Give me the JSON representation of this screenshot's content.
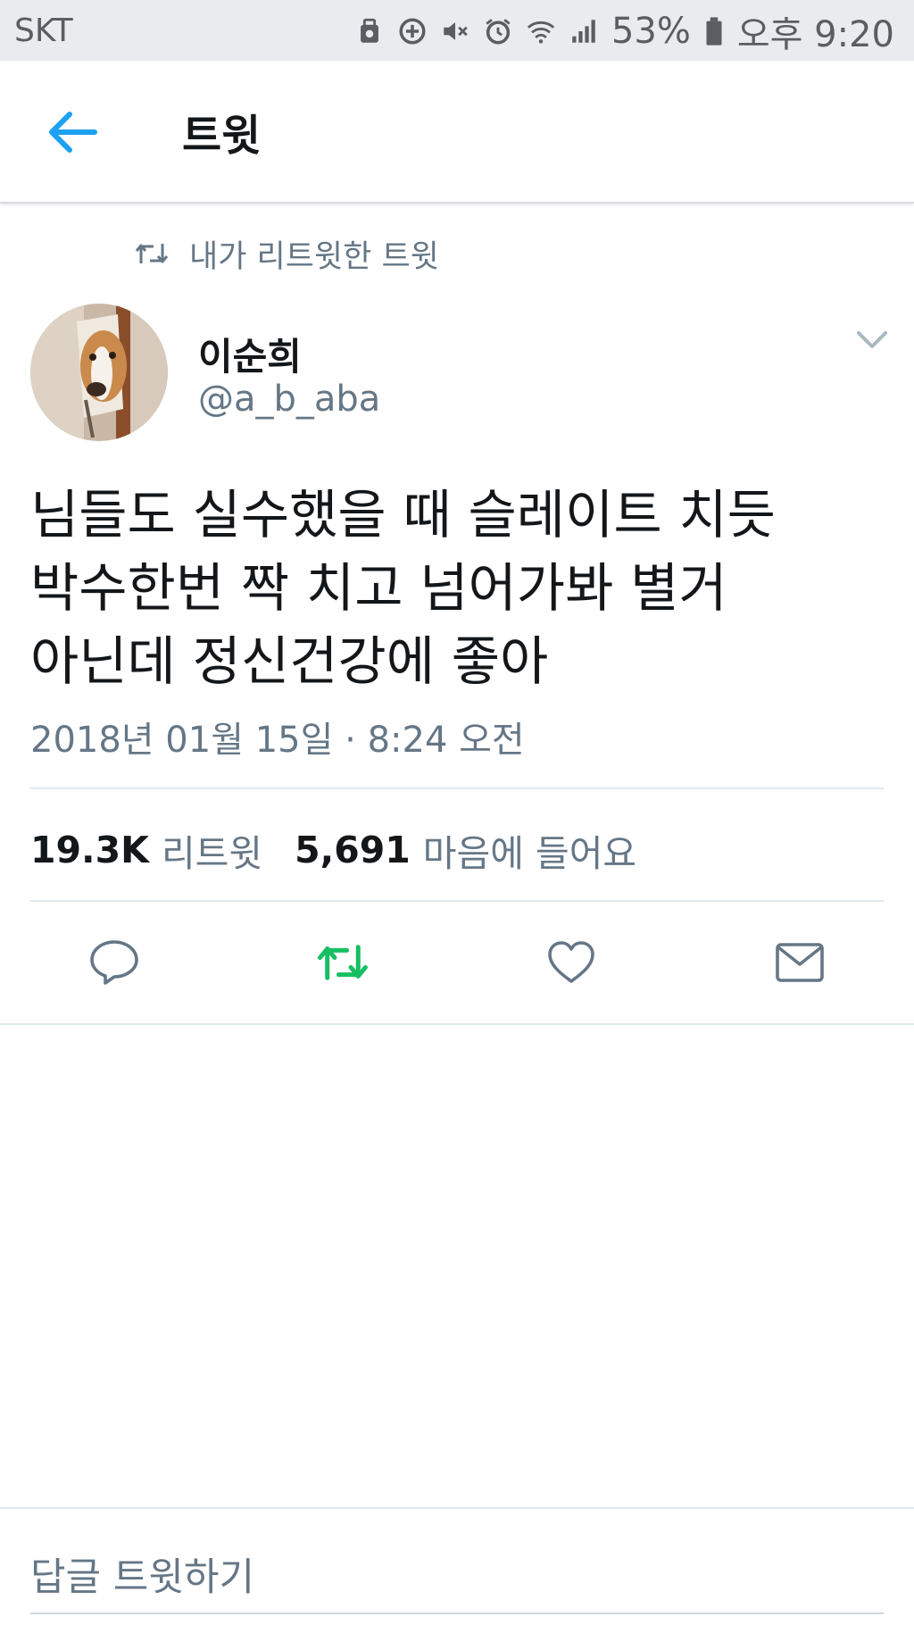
{
  "status_bar": {
    "carrier": "SKT",
    "battery_percent": "53%",
    "time": "오후 9:20",
    "icons": [
      "bag-icon",
      "sync-icon",
      "mute-icon",
      "alarm-icon",
      "wifi-icon",
      "signal-icon",
      "battery-icon"
    ]
  },
  "header": {
    "back_icon": "arrow-left-icon",
    "title": "트윗"
  },
  "tweet": {
    "retweet_context": "내가 리트윗한 트윗",
    "author_name": "이순희",
    "author_handle": "@a_b_aba",
    "text_lines": [
      "님들도 실수했을 때 슬레이트 치듯",
      "박수한번 짝 치고 넘어가봐 별거",
      "아닌데 정신건강에 좋아"
    ],
    "timestamp": "2018년 01월 15일 · 8:24 오전",
    "stats": {
      "retweets_count": "19.3K",
      "retweets_label": "리트윗",
      "likes_count": "5,691",
      "likes_label": "마음에 들어요"
    }
  },
  "actions": {
    "icons": [
      "reply-icon",
      "retweet-icon",
      "like-icon",
      "message-icon"
    ],
    "retweet_active": true
  },
  "reply_box": {
    "placeholder": "답글 트윗하기"
  },
  "colors": {
    "accent_blue": "#1da1f2",
    "retweet_green": "#17bf63",
    "secondary_text": "#657786",
    "primary_text": "#14171a",
    "status_bar_bg": "#e9ebee"
  }
}
